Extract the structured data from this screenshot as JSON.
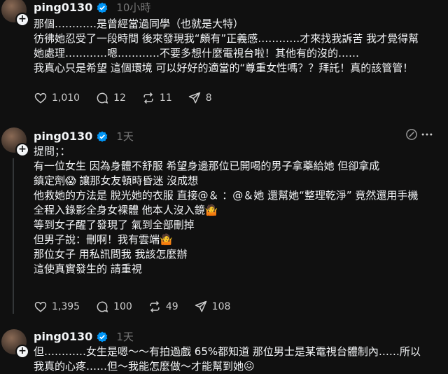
{
  "posts": [
    {
      "username": "ping0130",
      "time": "10小時",
      "lines": [
        "那個…………是曾經當過同學（也就是大特）",
        "彷彿她忍受了一段時間 後來發現我“頗有”正義感…………才來找我訴苦 我才覺得幫",
        "她處理…………嗯…………不要多想什麼電視台啦！其他有的沒的……",
        "我真心只是希望 這個環境 可以好好的適當的“尊重女性嗎？？拜託！真的該管管！"
      ],
      "likes": "1,010",
      "comments": "12",
      "reposts": "11",
      "shares": "8"
    },
    {
      "username": "ping0130",
      "time": "1天",
      "lines": [
        "提問；：",
        "有一位女生 因為身體不舒服 希望身邊那位已開喝的男子拿藥給她 但卻拿成",
        "鎮定劑😱 讓那女友頓時昏迷 沒成想",
        "他救她的方法是 脫光她的衣服 直接@＆ ：@＆她 還幫她“整理乾淨” 竟然還用手機",
        "全程入錄影全身女裸體 他本人沒入鏡🤷",
        "等到女子醒了發現了 氣到全部刪掉",
        "但男子說：刪啊！我有雲端🤷",
        "那位女子 用私訊問我 我該怎麼辦",
        "這使真實發生的 請重視"
      ],
      "likes": "1,395",
      "comments": "100",
      "reposts": "49",
      "shares": "108"
    },
    {
      "username": "ping0130",
      "time": "1天",
      "lines": [
        "但…………女生是嗯～～有拍過戲 65%都知道 那位男士是某電視台體制內……所以",
        "我真的心疼……但～我能怎麼做～才能幫到她😖"
      ]
    }
  ],
  "icons": {
    "verified_color": "#0095f6",
    "background": "#101010",
    "text": "#f3f5f7",
    "muted": "#777777"
  }
}
